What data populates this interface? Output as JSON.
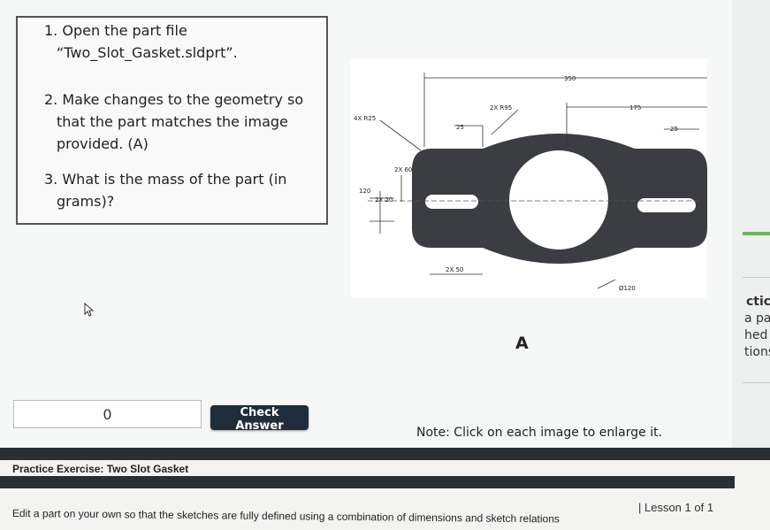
{
  "instructions": {
    "step1_line1": "1. Open the part file",
    "step1_line2": "“Two_Slot_Gasket.sldprt”.",
    "step2_line1": "2. Make changes to the geometry so",
    "step2_line2": "that the part matches the image",
    "step2_line3": "provided. (A)",
    "step3_line1": "3. What is the mass of the part (in",
    "step3_line2": "grams)?"
  },
  "drawing": {
    "dims": {
      "d350": "350",
      "r95": "2X R95",
      "d175": "175",
      "r25": "4X R25",
      "d25a": "25",
      "d25b": "25",
      "d60": "2X 60",
      "d120": "120",
      "d20": "2X 20",
      "d50": "2X 50",
      "dia120": "Ø120"
    },
    "image_label": "A"
  },
  "answer": {
    "value": "0",
    "check_label": "Check Answer"
  },
  "note": "Note: Click on each image to enlarge it.",
  "side_fragments": {
    "t1": "ctice",
    "t2": "a pa",
    "t3": "hed",
    "t4": "tions"
  },
  "footer": {
    "title": "Practice Exercise: Two Slot Gasket",
    "description": "Edit a part on your own so that the sketches are fully defined using a combination of dimensions and sketch relations",
    "lesson": "| Lesson 1 of 1"
  },
  "colors": {
    "gasket_fill": "#3b3d42",
    "button_bg": "#1f2d3a",
    "accent_green": "#6fb45a"
  }
}
